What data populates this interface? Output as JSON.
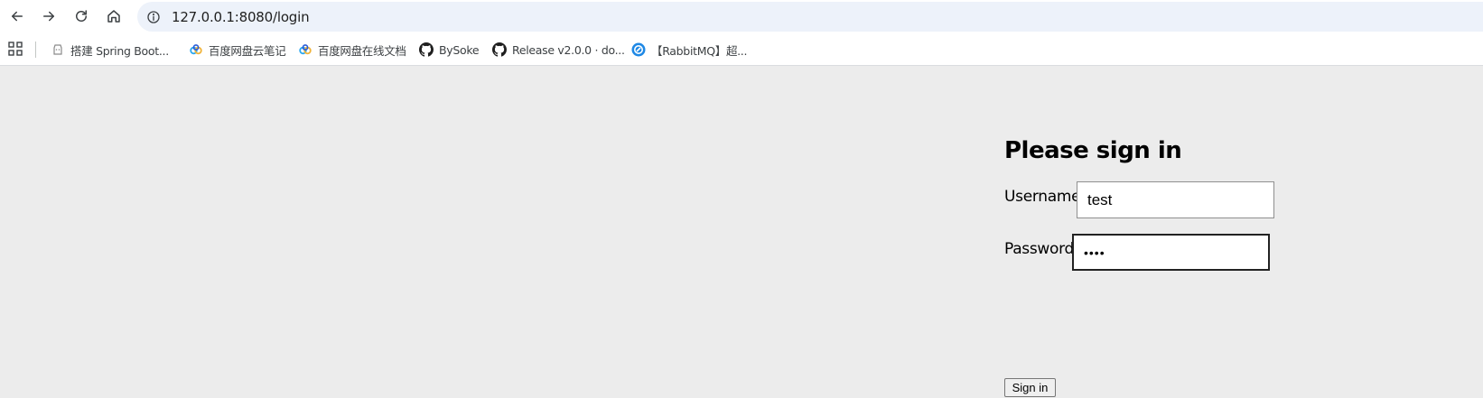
{
  "browser": {
    "url": "127.0.0.1:8080/login",
    "icons": [
      "back-arrow-icon",
      "forward-arrow-icon",
      "reload-icon",
      "home-icon",
      "site-info-icon"
    ]
  },
  "bookmarks": [
    {
      "label": "搭建 Spring Boot...",
      "icon": "spring-favicon-icon"
    },
    {
      "label": "百度网盘云笔记",
      "icon": "baidu-netdisk-icon"
    },
    {
      "label": "百度网盘在线文档",
      "icon": "baidu-netdisk-icon"
    },
    {
      "label": "BySoke",
      "icon": "github-icon"
    },
    {
      "label": "Release v2.0.0 · do...",
      "icon": "github-icon"
    },
    {
      "label": "【RabbitMQ】超...",
      "icon": "blue-circle-favicon-icon"
    }
  ],
  "login": {
    "heading": "Please sign in",
    "username_label": "Username",
    "username_value": "test",
    "password_label": "Password",
    "password_value": "••••",
    "submit_label": "Sign in"
  },
  "colors": {
    "page_bg": "#ececec",
    "omnibox_bg": "#edf2fa",
    "toolbar_bg": "#ffffff"
  }
}
